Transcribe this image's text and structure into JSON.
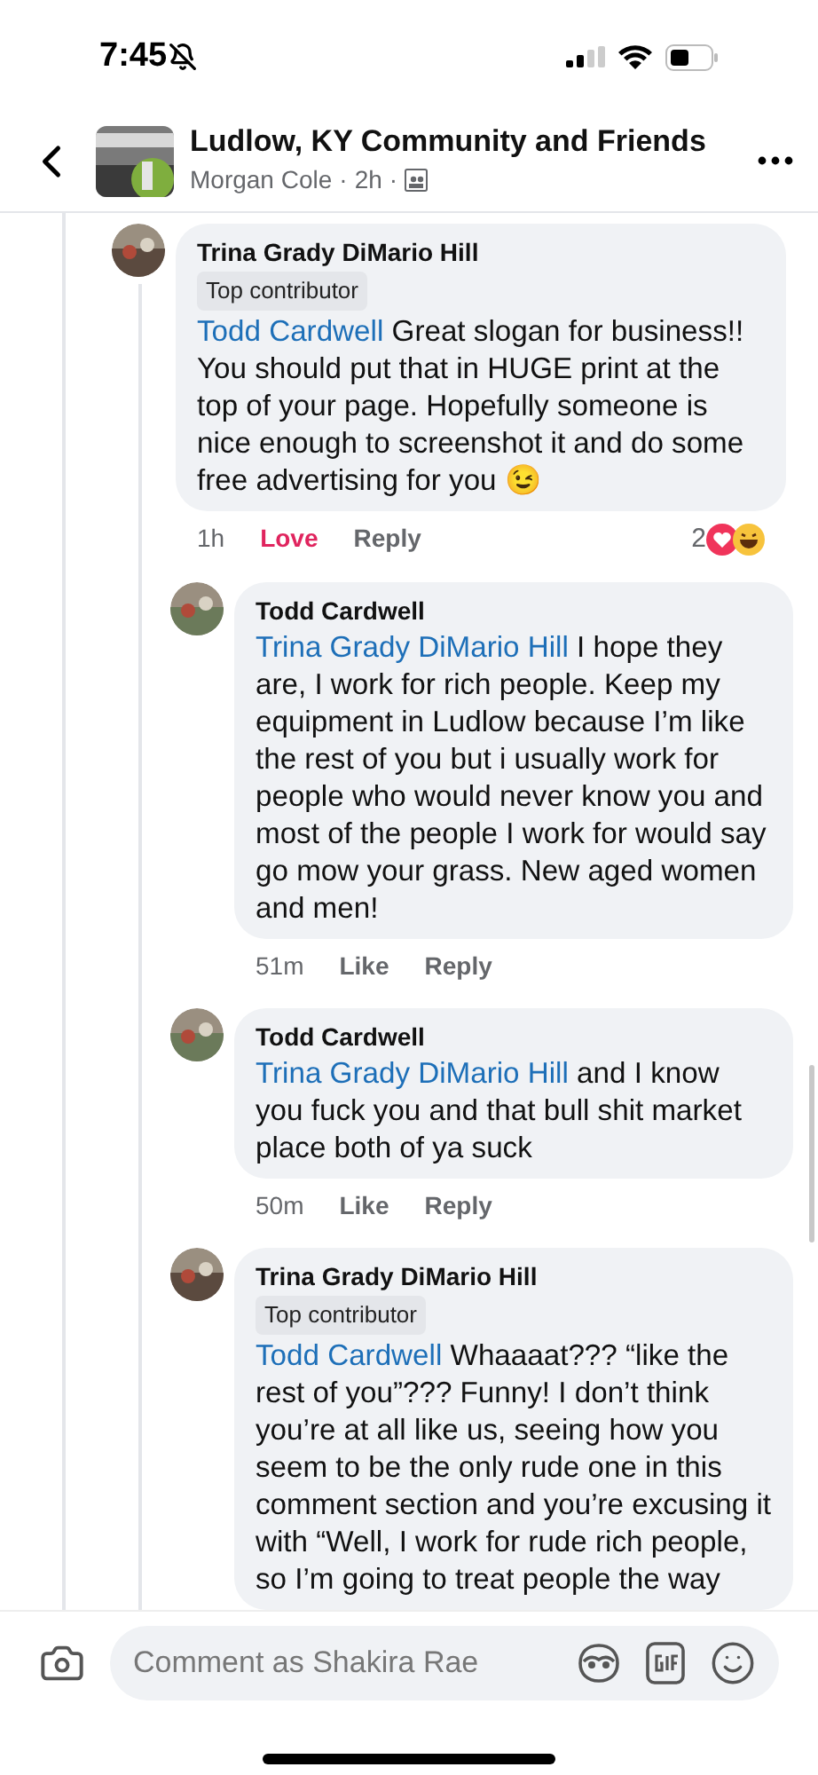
{
  "status_bar": {
    "time": "7:45"
  },
  "header": {
    "group_name": "Ludlow, KY Community and Friends",
    "author": "Morgan Cole",
    "age": "2h",
    "separator": "·"
  },
  "comments": [
    {
      "author": "Trina Grady DiMario Hill",
      "badge": "Top contributor",
      "mention": "Todd Cardwell",
      "text": "Great slogan for business!! You should put that in HUGE print at the top of your page. Hopefully someone is nice enough to screenshot it and do some free advertising for you",
      "emoji": "😉",
      "time": "1h",
      "reaction_label": "Love",
      "reacted": true,
      "reply_label": "Reply",
      "reaction_count": "2",
      "children": [
        {
          "author": "Todd Cardwell",
          "mention": "Trina Grady DiMario Hill",
          "text": "I hope they are, I work for rich people. Keep my equipment in Ludlow because I’m like the rest of you but i usually work for people who would never know you and most of the people I work for would say go mow your grass. New aged women and men!",
          "time": "51m",
          "reaction_label": "Like",
          "reacted": false,
          "reply_label": "Reply"
        },
        {
          "author": "Todd Cardwell",
          "mention": "Trina Grady DiMario Hill",
          "text": "and I know you fuck you and that bull shit market place both of ya suck",
          "time": "50m",
          "reaction_label": "Like",
          "reacted": false,
          "reply_label": "Reply"
        },
        {
          "author": "Trina Grady DiMario Hill",
          "badge": "Top contributor",
          "mention": "Todd Cardwell",
          "text": "Whaaaat??? “like the rest of you”??? Funny! I don’t think you’re at all like us, seeing how you seem to be the only rude one in this comment section and you’re excusing it with “Well, I work for rude rich people, so I’m going to treat people the way"
        }
      ]
    }
  ],
  "composer": {
    "placeholder": "Comment as Shakira Rae"
  }
}
